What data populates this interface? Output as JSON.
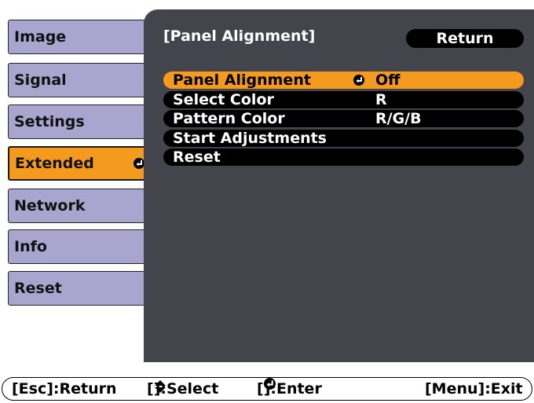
{
  "menu": {
    "tabs": [
      {
        "label": "Image"
      },
      {
        "label": "Signal"
      },
      {
        "label": "Settings"
      },
      {
        "label": "Extended"
      },
      {
        "label": "Network"
      },
      {
        "label": "Info"
      },
      {
        "label": "Reset"
      }
    ],
    "active_index": 3
  },
  "panel": {
    "title": "[Panel Alignment]",
    "return_label": "Return",
    "rows": [
      {
        "label": "Panel Alignment",
        "value": "Off"
      },
      {
        "label": "Select Color",
        "value": "R"
      },
      {
        "label": "Pattern Color",
        "value": "R/G/B"
      },
      {
        "label": "Start Adjustments",
        "value": ""
      },
      {
        "label": "Reset",
        "value": ""
      }
    ],
    "selected_index": 0
  },
  "help": {
    "esc_key": "[Esc]",
    "esc_action": ":Return",
    "select_open": "[",
    "select_close": "]:Select",
    "enter_open": "[",
    "enter_close": "]:Enter",
    "menu_text": "[Menu]:Exit"
  },
  "colors": {
    "tab_bg": "#a8a5ce",
    "accent_orange": "#f39a1f",
    "panel_bg": "#44444c",
    "row_bg": "#000000"
  },
  "icons": {
    "enter": "enter-icon",
    "updown": "updown-arrows-icon"
  }
}
